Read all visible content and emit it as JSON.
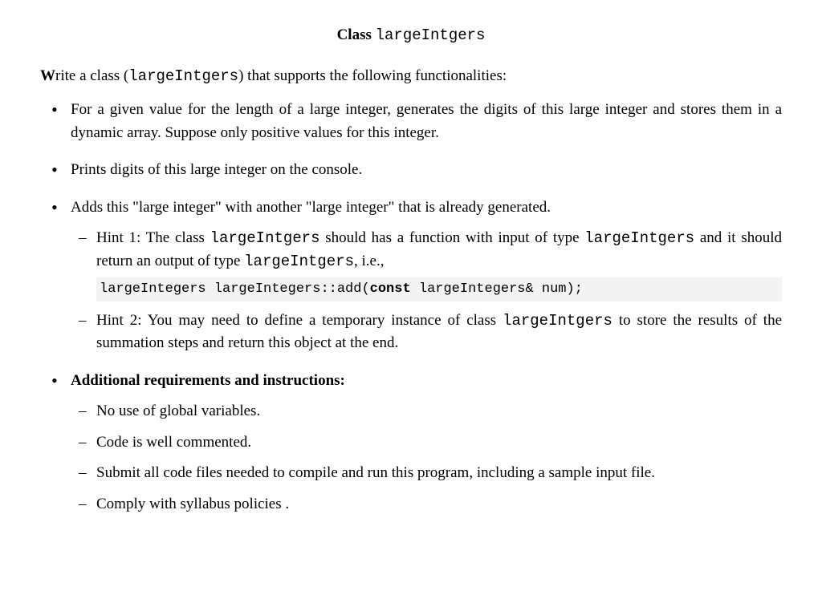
{
  "title": {
    "label": "Class",
    "classname": "largeIntgers"
  },
  "intro": {
    "firstLetter": "W",
    "prefix": "rite a class (",
    "classname": "largeIntgers",
    "suffix": ") that supports the following functionalities:"
  },
  "bullets": {
    "b1": "For a given value for the length of a large integer, generates the digits of this large integer and stores them in a dynamic array. Suppose only positive values for this integer.",
    "b2": "Prints digits of this large integer on the console.",
    "b3": {
      "main": "Adds this \"large integer\" with another \"large integer\" that is already generated.",
      "hint1": {
        "prefix": "Hint 1: The class ",
        "c1": "largeIntgers",
        "mid1": " should has a function with input of type ",
        "c2": "largeIntgers",
        "mid2": " and it should return an output of type ",
        "c3": "largeIntgers",
        "suffix": ", i.e.,"
      },
      "code": {
        "part1": "largeIntegers largeIntegers::add(",
        "kw": "const",
        "part2": " largeIntegers& num);"
      },
      "hint2": {
        "prefix": "Hint 2: You may need to define a temporary instance of class ",
        "c1": "largeIntgers",
        "suffix": " to store the results of the summation steps and return this object at the end."
      }
    },
    "b4": {
      "heading": "Additional requirements and instructions:",
      "i1": "No use of global variables.",
      "i2": "Code is well commented.",
      "i3": "Submit all code files needed to compile and run this program, including a sample input file.",
      "i4": "Comply with syllabus policies ."
    }
  }
}
